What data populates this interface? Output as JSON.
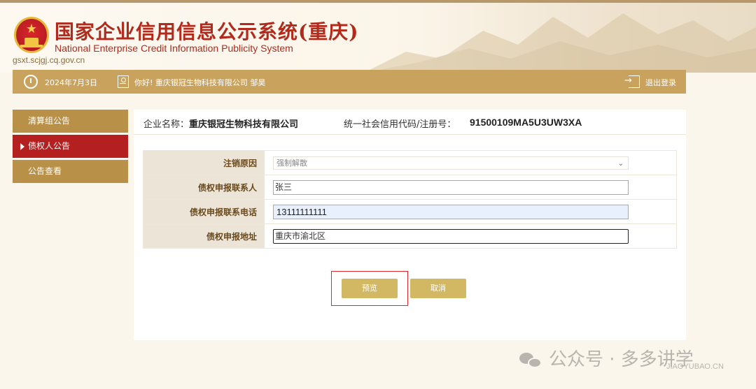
{
  "header": {
    "title": "国家企业信用信息公示系统(重庆)",
    "title_en": "National Enterprise Credit Information Publicity System",
    "url": "gsxt.scjgj.cq.gov.cn"
  },
  "infobar": {
    "date": "2024年7月3日",
    "greeting": "你好! 重庆银冠生物科技有限公司 邹昊",
    "logout": "退出登录"
  },
  "sidebar": {
    "items": [
      {
        "label": "清算组公告"
      },
      {
        "label": "债权人公告"
      },
      {
        "label": "公告查看"
      }
    ]
  },
  "company": {
    "name_label": "企业名称：",
    "name": "重庆银冠生物科技有限公司",
    "code_label": "统一社会信用代码/注册号：",
    "code": "91500109MA5U3UW3XA"
  },
  "form": {
    "reason_label": "注销原因",
    "reason_value": "强制解散",
    "contact_label": "债权申报联系人",
    "contact_value": "张三",
    "phone_label": "债权申报联系电话",
    "phone_value": "13111111111",
    "address_label": "债权申报地址",
    "address_value": "重庆市渝北区"
  },
  "buttons": {
    "preview": "预览",
    "cancel": "取消"
  },
  "watermark": {
    "text": "公众号 · 多多讲学",
    "sub": "JIAOYUBAO.CN"
  }
}
